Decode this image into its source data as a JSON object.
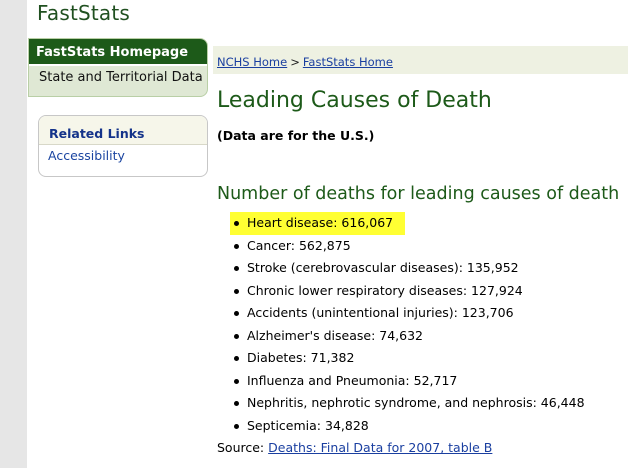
{
  "site": {
    "title": "FastStats"
  },
  "leftnav": {
    "items": [
      {
        "label": "FastStats Homepage"
      },
      {
        "label": "State and Territorial Data"
      }
    ]
  },
  "related_links": {
    "heading": "Related Links",
    "items": [
      {
        "label": "Accessibility"
      }
    ]
  },
  "breadcrumb": {
    "links": [
      {
        "label": "NCHS Home"
      },
      {
        "label": "FastStats Home"
      }
    ],
    "separator": ">"
  },
  "main": {
    "title": "Leading Causes of Death",
    "note": "(Data are for the U.S.)",
    "section_heading": "Number of deaths for leading causes of death",
    "causes": [
      "Heart disease: 616,067",
      "Cancer: 562,875",
      "Stroke (cerebrovascular diseases): 135,952",
      "Chronic lower respiratory diseases: 127,924",
      "Accidents (unintentional injuries): 123,706",
      "Alzheimer's disease: 74,632",
      "Diabetes: 71,382",
      "Influenza and Pneumonia: 52,717",
      "Nephritis, nephrotic syndrome, and nephrosis: 46,448",
      "Septicemia: 34,828"
    ],
    "highlighted_cause_index": 0,
    "source": {
      "prefix": "Source:",
      "link_label": "Deaths: Final Data for 2007, table B"
    }
  },
  "colors": {
    "brand_green": "#1d5a19",
    "nav_light": "#dfe8d4",
    "link_blue": "#1a3fa0",
    "highlight": "#ffff33"
  }
}
